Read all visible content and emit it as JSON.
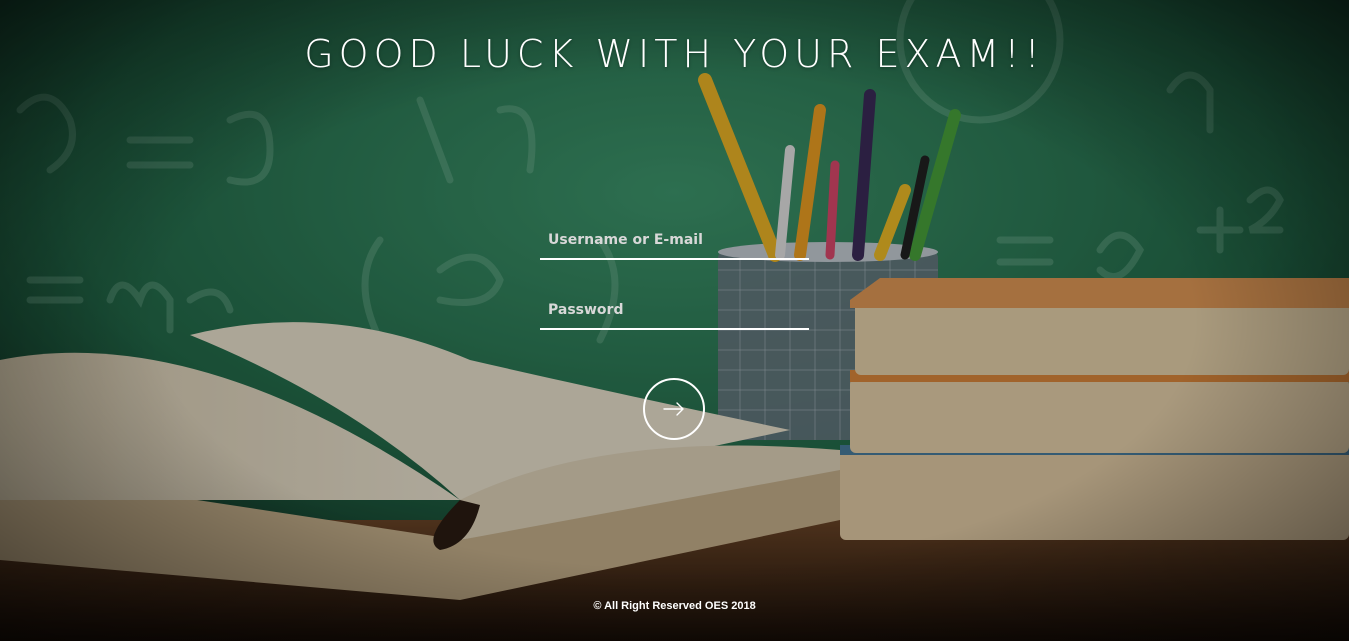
{
  "page": {
    "title": "GOOD LUCK WITH YOUR EXAM!!",
    "background_description_icon": "classroom-books-pencils-background"
  },
  "login_form": {
    "username_placeholder": "Username or E-mail",
    "password_placeholder": "Password",
    "submit_icon": "arrow-right-icon"
  },
  "footer": {
    "text": "© All Right Reserved OES 2018"
  },
  "colors": {
    "text": "#ffffff",
    "chalkboard": "#2e7d5b",
    "wood": "#5a3b22",
    "book_pages": "#e8dcc0"
  }
}
